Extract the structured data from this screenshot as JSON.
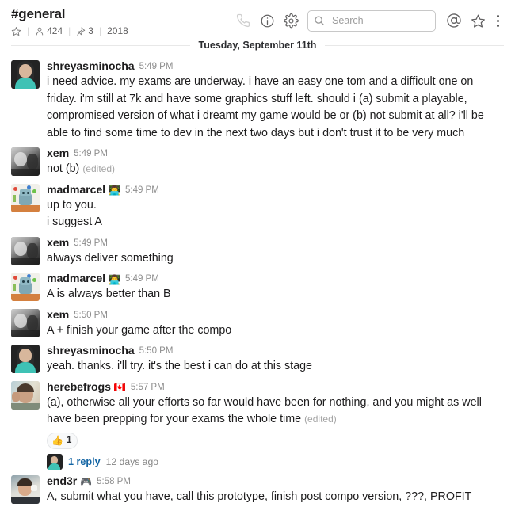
{
  "header": {
    "channel_name": "#general",
    "star_icon": "star-icon",
    "members_icon": "member-icon",
    "members_count": "424",
    "pins_icon": "pin-icon",
    "pins_count": "3",
    "topic": "2018",
    "separator": "|",
    "actions": {
      "call_icon": "phone-icon",
      "info_icon": "info-icon",
      "settings_icon": "gear-icon",
      "mentions_icon": "at-mention-icon",
      "star_icon": "star-outline-icon",
      "more_icon": "kebab-menu-icon"
    },
    "search": {
      "placeholder": "Search",
      "value": "",
      "icon": "search-icon"
    }
  },
  "divider": {
    "date_label": "Tuesday, September 11th"
  },
  "messages": [
    {
      "author": "shreyasminocha",
      "badge": "",
      "time": "5:49 PM",
      "avatar": "av-shreyas",
      "lines": [
        "i need advice. my exams are underway. i have an easy one tom and a difficult one on friday. i'm still at 7k and have some graphics stuff left. should i (a) submit a playable, compromised version of what i dreamt my game would be or (b) not submit at all? i'll be able to find some time to dev in the next two days but i don't trust it to be very much"
      ],
      "edited": "",
      "reactions": [],
      "thread": null
    },
    {
      "author": "xem",
      "badge": "",
      "time": "5:49 PM",
      "avatar": "av-xem",
      "lines": [
        "not (b)"
      ],
      "edited": "(edited)",
      "reactions": [],
      "thread": null
    },
    {
      "author": "madmarcel",
      "badge": "👨‍💻",
      "time": "5:49 PM",
      "avatar": "av-madmarcel",
      "lines": [
        "up to you.",
        "i suggest A"
      ],
      "edited": "",
      "reactions": [],
      "thread": null
    },
    {
      "author": "xem",
      "badge": "",
      "time": "5:49 PM",
      "avatar": "av-xem",
      "lines": [
        "always deliver something"
      ],
      "edited": "",
      "reactions": [],
      "thread": null
    },
    {
      "author": "madmarcel",
      "badge": "👨‍💻",
      "time": "5:49 PM",
      "avatar": "av-madmarcel",
      "lines": [
        "A is always better than B"
      ],
      "edited": "",
      "reactions": [],
      "thread": null
    },
    {
      "author": "xem",
      "badge": "",
      "time": "5:50 PM",
      "avatar": "av-xem",
      "lines": [
        "A + finish your game after the compo"
      ],
      "edited": "",
      "reactions": [],
      "thread": null
    },
    {
      "author": "shreyasminocha",
      "badge": "",
      "time": "5:50 PM",
      "avatar": "av-shreyas",
      "lines": [
        "yeah. thanks. i'll try. it's the best i can do at this stage"
      ],
      "edited": "",
      "reactions": [],
      "thread": null
    },
    {
      "author": "herebefrogs",
      "badge": "🇨🇦",
      "time": "5:57 PM",
      "avatar": "av-frogs",
      "lines": [
        "(a), otherwise all your efforts so far would have been for nothing, and you might as well have been prepping for your exams the whole time"
      ],
      "edited": "(edited)",
      "reactions": [
        {
          "emoji": "👍",
          "count": "1"
        }
      ],
      "thread": {
        "count_label": "1 reply",
        "time_label": "12 days ago",
        "avatar": "av-thread"
      }
    },
    {
      "author": "end3r",
      "badge": "🎮",
      "time": "5:58 PM",
      "avatar": "av-end3r",
      "lines": [
        "A, submit what you have, call this prototype, finish post compo version, ???, PROFIT"
      ],
      "edited": "",
      "reactions": [],
      "thread": null
    }
  ],
  "colors": {
    "text": "#1d1c1d",
    "muted": "#8d8d8d",
    "link": "#1264a3",
    "border": "#e8e8e8"
  }
}
